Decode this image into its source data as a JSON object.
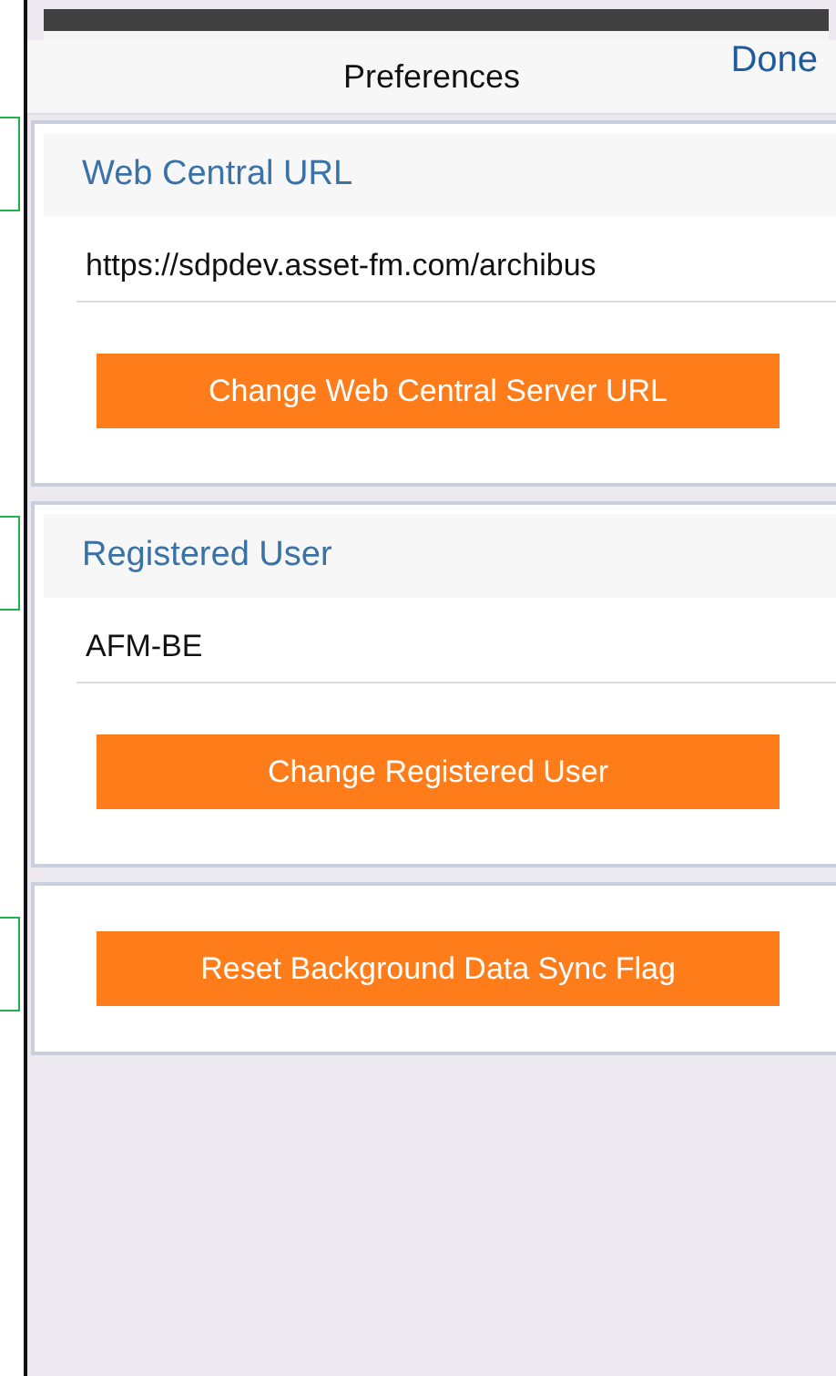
{
  "header": {
    "title": "Preferences",
    "done_label": "Done"
  },
  "sections": [
    {
      "title": "Web Central URL",
      "value": "https://sdpdev.asset-fm.com/archibus",
      "button": "Change Web Central Server URL"
    },
    {
      "title": "Registered User",
      "value": "AFM-BE",
      "button": "Change Registered User"
    },
    {
      "button": "Reset Background Data Sync Flag"
    }
  ]
}
